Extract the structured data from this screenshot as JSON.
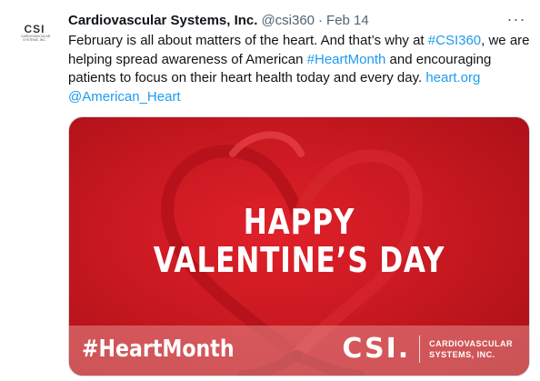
{
  "tweet": {
    "avatar": {
      "logo": "CSI",
      "subtitle": "CARDIOVASCULAR SYSTEMS, INC."
    },
    "author_name": "Cardiovascular Systems, Inc.",
    "handle": "@csi360",
    "separator": "·",
    "date": "Feb 14",
    "more": "···",
    "text": {
      "part1": "February is all about matters of the heart. And that’s why at ",
      "tag1": "#CSI360",
      "part2": ", we are helping spread awareness of American ",
      "tag2": "#HeartMonth",
      "part3": " and encouraging patients to focus on their heart health today and every day. ",
      "link1": "heart.org",
      "part4": " ",
      "mention": "@American_Heart"
    },
    "media": {
      "line1": "HAPPY",
      "line2": "VALENTINE’S DAY",
      "hashtag": "#HeartMonth",
      "brand_logo": "CSI.",
      "brand_line1": "CARDIOVASCULAR",
      "brand_line2": "SYSTEMS, INC."
    },
    "colors": {
      "link": "#1d9bf0",
      "media_red": "#cc1a22"
    }
  }
}
